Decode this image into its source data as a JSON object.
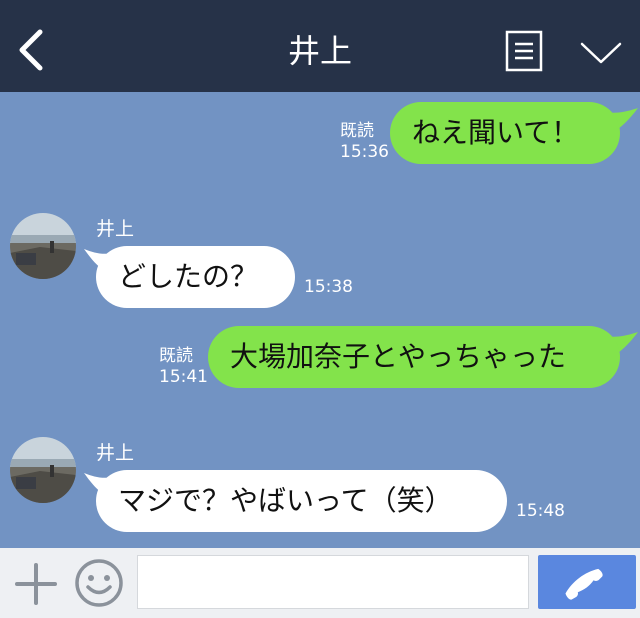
{
  "header": {
    "title": "井上",
    "background": "#263248",
    "back_icon": "chevron-left-icon",
    "menu_icon": "notes-icon",
    "collapse_icon": "chevron-down-icon"
  },
  "chat": {
    "background": "#7293c3",
    "outgoing_bubble_color": "#83e34b",
    "incoming_bubble_color": "#ffffff",
    "messages": [
      {
        "direction": "out",
        "text": "ねえ聞いて！",
        "read": "既読",
        "time": "15:36"
      },
      {
        "direction": "in",
        "sender": "井上",
        "text": "どしたの？",
        "time": "15:38"
      },
      {
        "direction": "out",
        "text": "大場加奈子とやっちゃった",
        "read": "既読",
        "time": "15:41"
      },
      {
        "direction": "in",
        "sender": "井上",
        "text": "マジで？やばいって（笑）",
        "time": "15:48"
      }
    ]
  },
  "footer": {
    "plus_icon": "plus-icon",
    "emoji_icon": "smiley-icon",
    "input_value": "",
    "input_placeholder": "",
    "call_icon": "phone-icon",
    "call_color": "#5a87df"
  }
}
